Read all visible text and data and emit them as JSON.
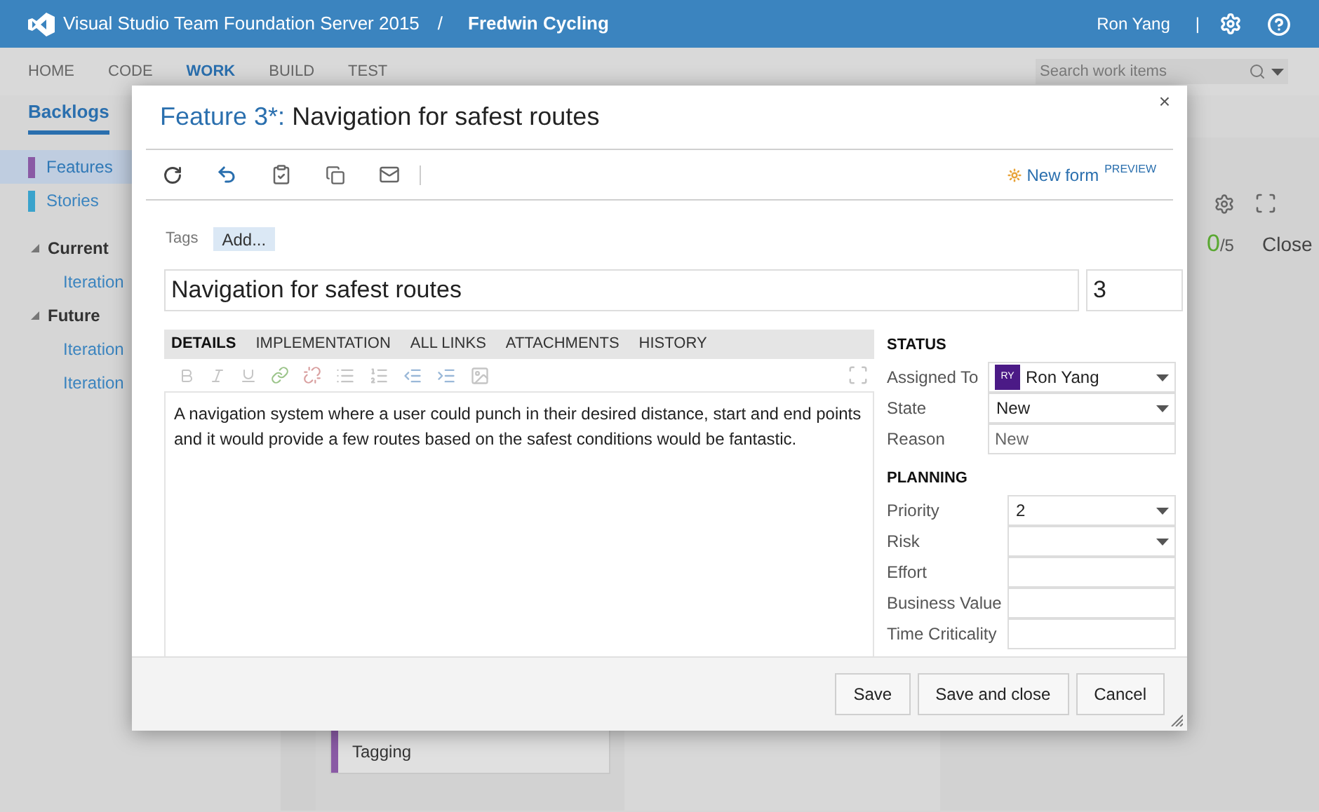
{
  "header": {
    "product": "Visual Studio Team Foundation Server 2015",
    "separator": "/",
    "project": "Fredwin Cycling",
    "user": "Ron Yang",
    "divider": "|"
  },
  "nav": [
    {
      "label": "HOME",
      "selected": false
    },
    {
      "label": "CODE",
      "selected": false
    },
    {
      "label": "WORK",
      "selected": true
    },
    {
      "label": "BUILD",
      "selected": false
    },
    {
      "label": "TEST",
      "selected": false
    }
  ],
  "search": {
    "placeholder": "Search work items"
  },
  "subnav": [
    {
      "label": "Backlogs",
      "selected": true
    }
  ],
  "sidebar": {
    "backlogs": [
      {
        "label": "Features",
        "color": "#8a5aa5",
        "selected": true
      },
      {
        "label": "Stories",
        "color": "#3aa3cc",
        "selected": false
      }
    ],
    "groups": [
      {
        "label": "Current",
        "expanded": true,
        "children": [
          {
            "label": "Iteration"
          }
        ]
      },
      {
        "label": "Future",
        "expanded": true,
        "children": [
          {
            "label": "Iteration"
          },
          {
            "label": "Iteration"
          }
        ]
      }
    ]
  },
  "board": {
    "done": "0",
    "total": "/5",
    "column": "Close",
    "cards": [
      {
        "title": "Tagging",
        "color": "#8a5aa5"
      }
    ]
  },
  "dialog": {
    "type_label": "Feature 3*:",
    "title": "Navigation for safest routes",
    "close": "×",
    "new_form": "New form",
    "preview": "PREVIEW",
    "tags_label": "Tags",
    "add_tag": "Add...",
    "title_value": "Navigation for safest routes",
    "id_value": "3",
    "tabs": [
      {
        "label": "DETAILS",
        "selected": true
      },
      {
        "label": "IMPLEMENTATION",
        "selected": false
      },
      {
        "label": "ALL LINKS",
        "selected": false
      },
      {
        "label": "ATTACHMENTS",
        "selected": false
      },
      {
        "label": "HISTORY",
        "selected": false
      }
    ],
    "description": "A navigation system where a user could punch in their desired distance, start and end points and it would provide a few routes based on the safest conditions would be fantastic.",
    "sections": [
      {
        "heading": "STATUS",
        "fields": [
          {
            "label": "Assigned To",
            "value": "Ron Yang",
            "initials": "RY",
            "kind": "person"
          },
          {
            "label": "State",
            "value": "New",
            "kind": "dropdown"
          },
          {
            "label": "Reason",
            "value": "New",
            "kind": "readonly"
          }
        ]
      },
      {
        "heading": "PLANNING",
        "fields": [
          {
            "label": "Priority",
            "value": "2",
            "kind": "dropdown"
          },
          {
            "label": "Risk",
            "kind": "dropdown"
          },
          {
            "label": "Effort",
            "kind": "text"
          },
          {
            "label": "Business Value",
            "kind": "text"
          },
          {
            "label": "Time Criticality",
            "kind": "text"
          }
        ]
      }
    ],
    "buttons": [
      "Save",
      "Save and close",
      "Cancel"
    ]
  }
}
